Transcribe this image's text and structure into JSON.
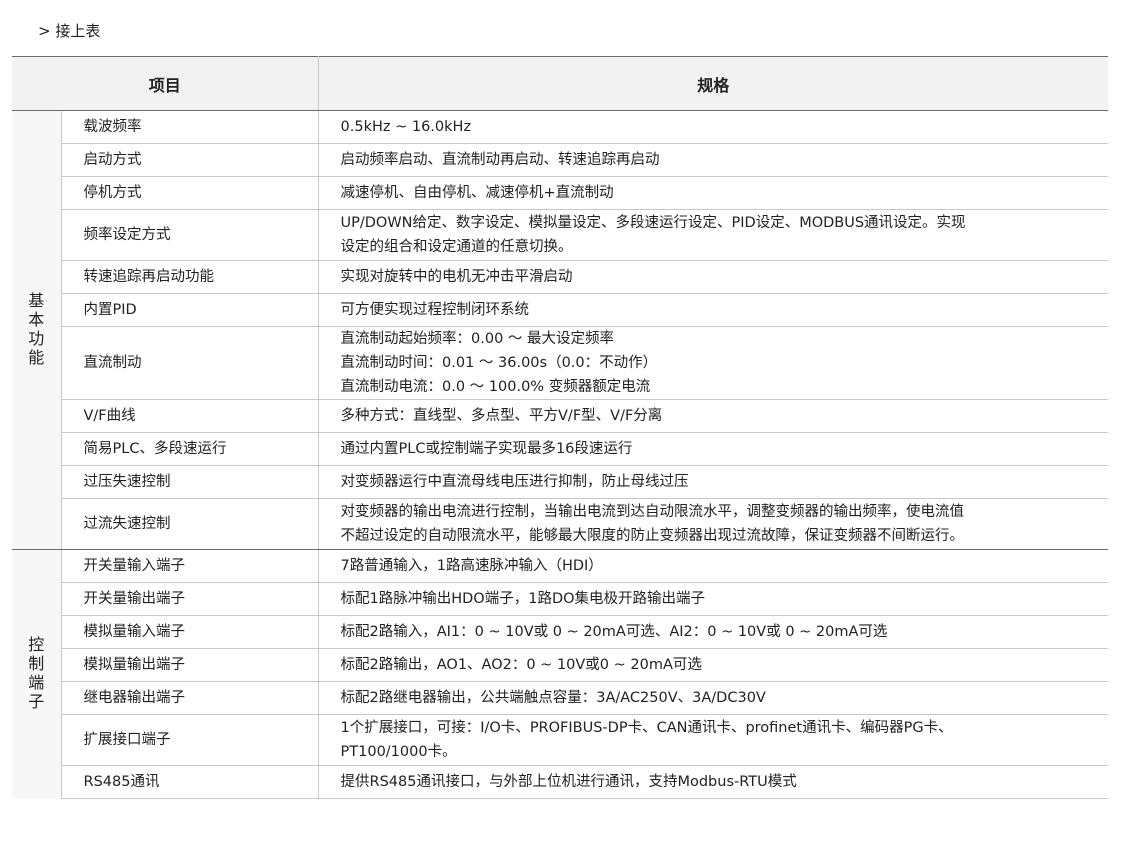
{
  "continued_label": "> 接上表",
  "header": {
    "item": "项目",
    "spec": "规格"
  },
  "groups": [
    {
      "label": "基本功能",
      "rows": [
        {
          "item": "载波频率",
          "spec": [
            "0.5kHz ~ 16.0kHz"
          ]
        },
        {
          "item": "启动方式",
          "spec": [
            "启动频率启动、直流制动再启动、转速追踪再启动"
          ]
        },
        {
          "item": "停机方式",
          "spec": [
            "减速停机、自由停机、减速停机+直流制动"
          ]
        },
        {
          "item": "频率设定方式",
          "spec": [
            "UP/DOWN给定、数字设定、模拟量设定、多段速运行设定、PID设定、MODBUS通讯设定。实现",
            "设定的组合和设定通道的任意切换。"
          ]
        },
        {
          "item": "转速追踪再启动功能",
          "spec": [
            "实现对旋转中的电机无冲击平滑启动"
          ]
        },
        {
          "item": "内置PID",
          "spec": [
            "可方便实现过程控制闭环系统"
          ]
        },
        {
          "item": "直流制动",
          "spec": [
            "直流制动起始频率：0.00 ～ 最大设定频率",
            "直流制动时间：0.01 ～ 36.00s（0.0：不动作）",
            "直流制动电流：0.0 ～ 100.0% 变频器额定电流"
          ]
        },
        {
          "item": "V/F曲线",
          "spec": [
            "多种方式：直线型、多点型、平方V/F型、V/F分离"
          ]
        },
        {
          "item": "简易PLC、多段速运行",
          "spec": [
            "通过内置PLC或控制端子实现最多16段速运行"
          ]
        },
        {
          "item": "过压失速控制",
          "spec": [
            "对变频器运行中直流母线电压进行抑制，防止母线过压"
          ]
        },
        {
          "item": "过流失速控制",
          "spec": [
            "对变频器的输出电流进行控制，当输出电流到达自动限流水平，调整变频器的输出频率，使电流值",
            "不超过设定的自动限流水平，能够最大限度的防止变频器出现过流故障，保证变频器不间断运行。"
          ]
        }
      ]
    },
    {
      "label": "控制端子",
      "rows": [
        {
          "item": "开关量输入端子",
          "spec": [
            "7路普通输入，1路高速脉冲输入（HDI）"
          ]
        },
        {
          "item": "开关量输出端子",
          "spec": [
            "标配1路脉冲输出HDO端子，1路DO集电极开路输出端子"
          ]
        },
        {
          "item": "模拟量输入端子",
          "spec": [
            "标配2路输入，AI1：0 ~ 10V或 0 ~ 20mA可选、AI2：0 ~ 10V或 0 ~ 20mA可选"
          ]
        },
        {
          "item": "模拟量输出端子",
          "spec": [
            "标配2路输出，AO1、AO2：0 ~ 10V或0 ~ 20mA可选"
          ]
        },
        {
          "item": "继电器输出端子",
          "spec": [
            "标配2路继电器输出，公共端触点容量：3A/AC250V、3A/DC30V"
          ]
        },
        {
          "item": "扩展接口端子",
          "spec": [
            "1个扩展接口，可接：I/O卡、PROFIBUS-DP卡、CAN通讯卡、profinet通讯卡、编码器PG卡、",
            "PT100/1000卡。"
          ]
        },
        {
          "item": "RS485通讯",
          "spec": [
            "提供RS485通讯接口，与外部上位机进行通讯，支持Modbus-RTU模式"
          ]
        }
      ]
    }
  ]
}
